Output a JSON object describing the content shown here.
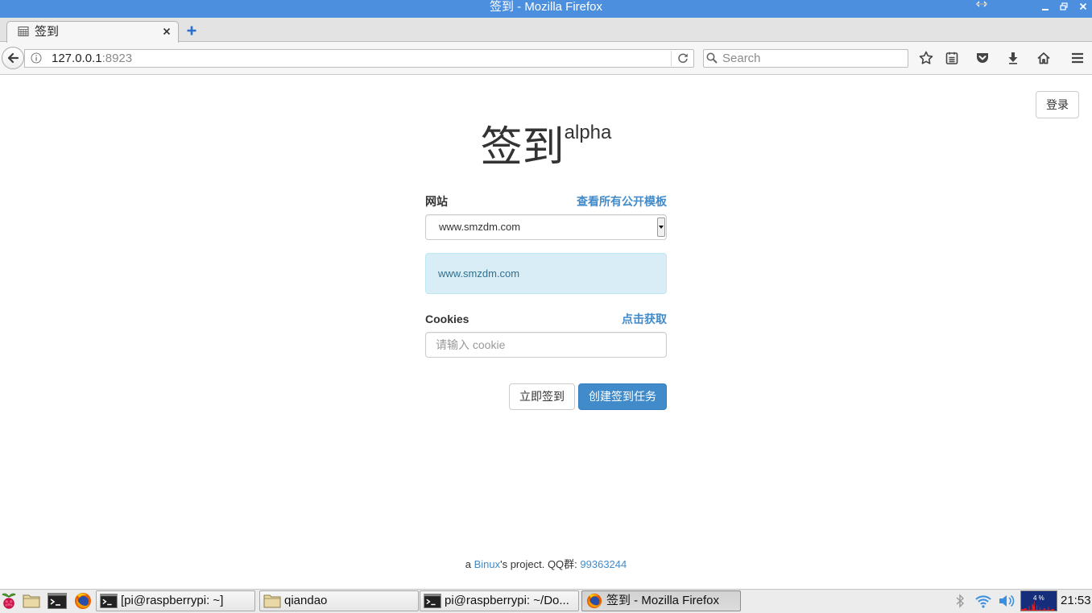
{
  "window": {
    "title": "签到 - Mozilla Firefox"
  },
  "tabs": [
    {
      "label": "签到",
      "icon": "calendar-icon"
    }
  ],
  "nav": {
    "url_host": "127.0.0.1",
    "url_port": ":8923",
    "search_placeholder": "Search",
    "toolbar_icons": [
      "bookmark-star-icon",
      "bookmarks-menu-icon",
      "pocket-icon",
      "download-icon",
      "home-icon",
      "menu-icon"
    ]
  },
  "page": {
    "login_button": "登录",
    "heading": "签到",
    "heading_sup": "alpha",
    "site": {
      "label": "网站",
      "templates_link": "查看所有公开模板",
      "selected": "www.smzdm.com",
      "info": "www.smzdm.com"
    },
    "cookies": {
      "label": "Cookies",
      "fetch_link": "点击获取",
      "placeholder": "请输入 cookie"
    },
    "buttons": {
      "sign_now": "立即签到",
      "create_task": "创建签到任务"
    },
    "footer": {
      "prefix": "a ",
      "author": "Binux",
      "middle": "'s project. QQ群: ",
      "qq": "99363244"
    }
  },
  "taskbar": {
    "launchers": [
      "raspberry-menu-icon",
      "file-manager-icon",
      "terminal-icon",
      "firefox-icon"
    ],
    "tasks": [
      {
        "label": "[pi@raspberrypi: ~]",
        "icon": "terminal-icon"
      },
      {
        "label": "qiandao",
        "icon": "folder-icon"
      },
      {
        "label": "pi@raspberrypi: ~/Do...",
        "icon": "terminal-icon"
      },
      {
        "label": "签到 - Mozilla Firefox",
        "icon": "firefox-icon",
        "active": true
      }
    ],
    "tray_icons": [
      "bluetooth-icon",
      "wifi-icon",
      "volume-icon",
      "cpu-monitor-icon"
    ],
    "cpu_usage": "4 %",
    "clock": "21:53"
  },
  "colors": {
    "titlebar": "#4b8fde",
    "link": "#428bca",
    "primary_button": "#428bca",
    "info_background": "#d9edf7",
    "info_text": "#31708f"
  }
}
